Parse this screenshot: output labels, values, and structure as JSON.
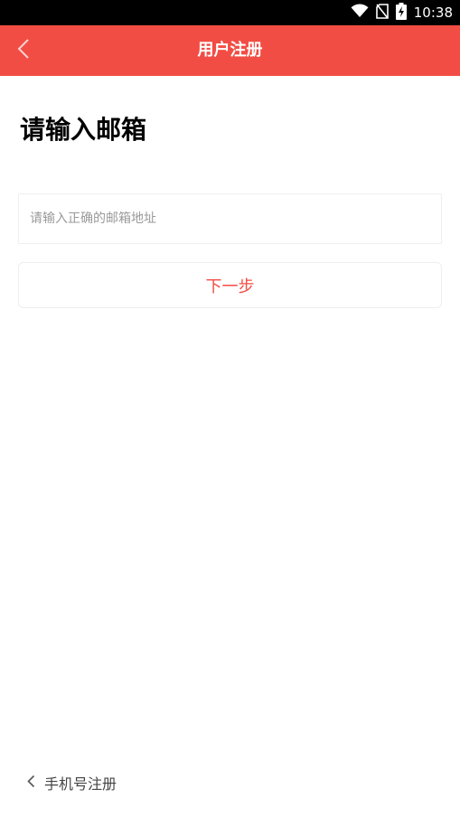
{
  "status_bar": {
    "time": "10:38",
    "icons": [
      "wifi-icon",
      "no-sim-icon",
      "battery-charging-icon"
    ]
  },
  "app_bar": {
    "title": "用户注册",
    "back_icon": "chevron-left-icon",
    "background_color": "#f24d44"
  },
  "main": {
    "heading": "请输入邮箱",
    "email_placeholder": "请输入正确的邮箱地址",
    "email_value": "",
    "next_label": "下一步"
  },
  "footer": {
    "phone_register_label": "手机号注册",
    "icon": "chevron-left-icon"
  },
  "colors": {
    "accent": "#f24d44",
    "text_primary": "#000000",
    "placeholder": "#9a9a9a"
  }
}
